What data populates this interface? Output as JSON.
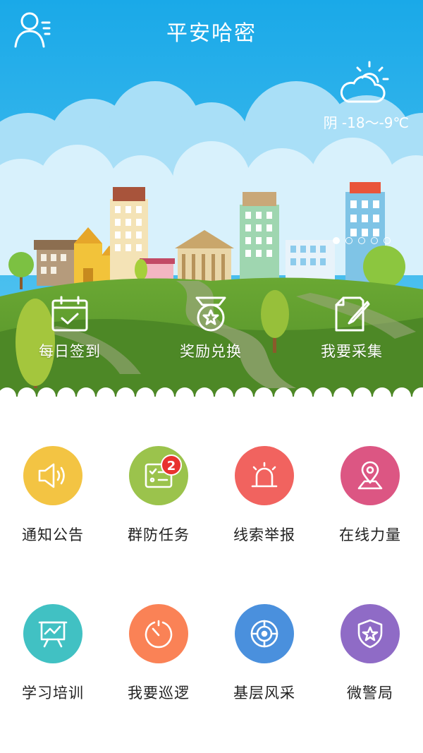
{
  "header": {
    "title": "平安哈密"
  },
  "weather": {
    "text": "阴 -18～-9℃",
    "icon": "partly-cloudy-icon"
  },
  "carousel": {
    "page_count": 5,
    "active_index": 0
  },
  "quick_actions": [
    {
      "label": "每日签到",
      "icon": "calendar-check-icon"
    },
    {
      "label": "奖励兑换",
      "icon": "medal-star-icon"
    },
    {
      "label": "我要采集",
      "icon": "edit-note-icon"
    }
  ],
  "grid": [
    {
      "label": "通知公告",
      "icon": "speaker-icon",
      "color": "#f3c443"
    },
    {
      "label": "群防任务",
      "icon": "task-list-icon",
      "color": "#9bc34c",
      "badge": "2"
    },
    {
      "label": "线索举报",
      "icon": "siren-icon",
      "color": "#f1635f"
    },
    {
      "label": "在线力量",
      "icon": "location-pin-icon",
      "color": "#dc5683"
    },
    {
      "label": "学习培训",
      "icon": "presentation-board-icon",
      "color": "#41c1c3"
    },
    {
      "label": "我要巡逻",
      "icon": "stopwatch-icon",
      "color": "#fa8256"
    },
    {
      "label": "基层风采",
      "icon": "radar-icon",
      "color": "#4a90dd"
    },
    {
      "label": "微警局",
      "icon": "police-shield-icon",
      "color": "#8f6bc6"
    }
  ],
  "colors": {
    "sky": "#22b0ea",
    "grass": "#5d9a2f",
    "badge": "#e8322f"
  }
}
